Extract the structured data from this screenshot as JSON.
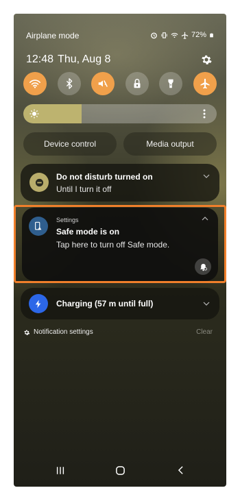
{
  "status_bar": {
    "left_text": "Airplane mode",
    "battery": "72%"
  },
  "header": {
    "time": "12:48",
    "date": "Thu, Aug 8"
  },
  "quick_settings": {
    "tiles": [
      {
        "name": "wifi",
        "icon": "wifi-icon",
        "state": "on"
      },
      {
        "name": "bluetooth",
        "icon": "bluetooth-icon",
        "state": "off"
      },
      {
        "name": "sound",
        "icon": "mute-icon",
        "state": "on"
      },
      {
        "name": "screen-lock",
        "icon": "lock-icon",
        "state": "off"
      },
      {
        "name": "flashlight",
        "icon": "flashlight-icon",
        "state": "off"
      },
      {
        "name": "airplane",
        "icon": "airplane-icon",
        "state": "on"
      }
    ],
    "brightness_level": 0.3,
    "device_control": "Device control",
    "media_output": "Media output"
  },
  "notifications": {
    "dnd": {
      "title": "Do not disturb turned on",
      "subtitle": "Until I turn it off"
    },
    "safe_mode": {
      "app": "Settings",
      "title": "Safe mode is on",
      "subtitle": "Tap here to turn off Safe mode."
    },
    "charging": {
      "title": "Charging (57 m until full)"
    }
  },
  "footer": {
    "notification_settings": "Notification settings",
    "clear": "Clear"
  },
  "colors": {
    "accent_on": "#f0a04b",
    "highlight": "#f07f2b",
    "charging": "#2c67e8",
    "safe_mode": "#2f5e8e",
    "dnd": "#b9ad6b"
  }
}
